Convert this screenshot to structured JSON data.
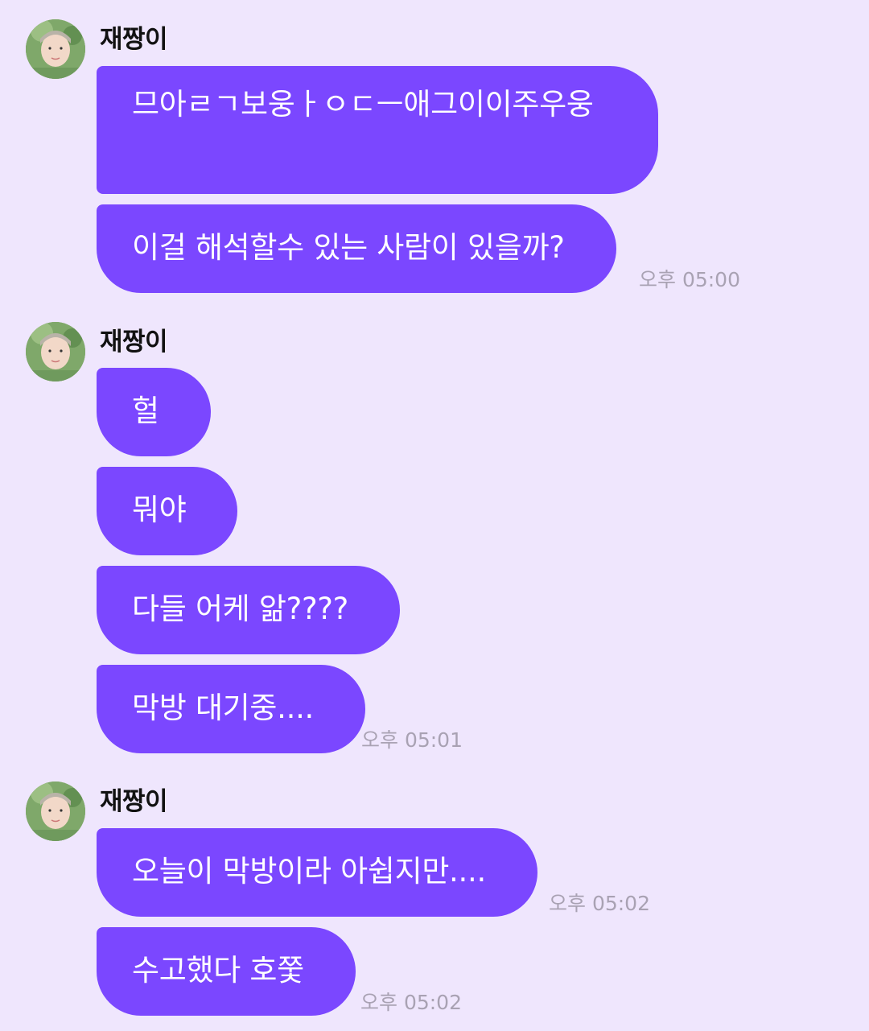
{
  "chat": {
    "groups": [
      {
        "sender": "재짱이",
        "messages": [
          {
            "text": "므아ㄹㄱ보웅ㅏㅇㄷㅡ애그이이주우웅"
          },
          {
            "text": "이걸 해석할수 있는 사람이 있을까?",
            "time": "오후 05:00"
          }
        ]
      },
      {
        "sender": "재짱이",
        "messages": [
          {
            "text": "헐"
          },
          {
            "text": "뭐야"
          },
          {
            "text": "다들 어케 앎????"
          },
          {
            "text": "막방 대기중....",
            "time": "오후 05:01"
          }
        ]
      },
      {
        "sender": "재짱이",
        "messages": [
          {
            "text": "오늘이 막방이라 아쉽지만....",
            "time": "오후 05:02"
          },
          {
            "text": "수고했다 호쭟",
            "time": "오후 05:02"
          }
        ]
      }
    ]
  },
  "icons": {
    "avatar": "profile-photo"
  },
  "colors": {
    "background": "#efe6fd",
    "bubble": "#7b47ff",
    "bubble_text": "#ffffff",
    "timestamp": "#a9a2b3"
  }
}
